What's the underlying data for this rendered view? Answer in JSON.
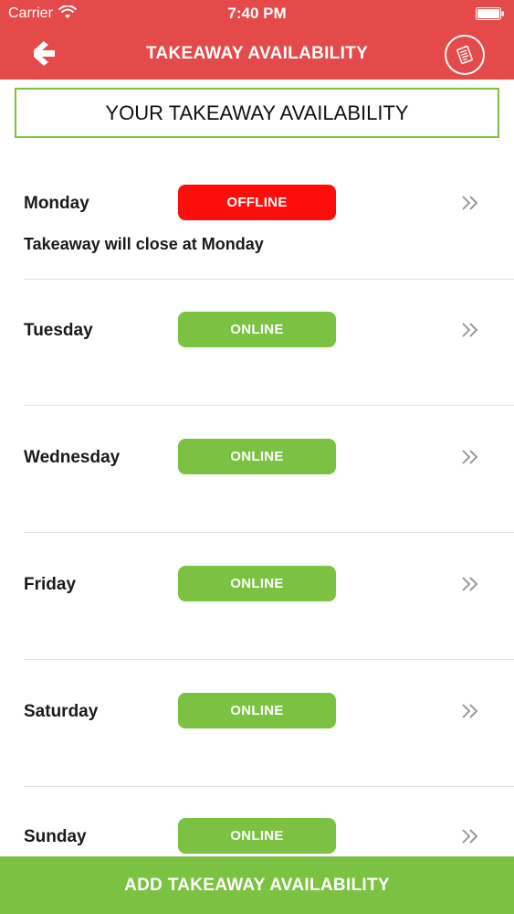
{
  "status_bar": {
    "carrier": "Carrier",
    "time": "7:40 PM"
  },
  "nav": {
    "title": "TAKEAWAY AVAILABILITY",
    "back_icon": "arrow-left-icon",
    "action_icon": "receipt-icon"
  },
  "header": {
    "title": "YOUR TAKEAWAY AVAILABILITY"
  },
  "days": [
    {
      "day": "Monday",
      "status": "OFFLINE",
      "note": "Takeaway will close at Monday"
    },
    {
      "day": "Tuesday",
      "status": "ONLINE",
      "note": ""
    },
    {
      "day": "Wednesday",
      "status": "ONLINE",
      "note": ""
    },
    {
      "day": "Friday",
      "status": "ONLINE",
      "note": ""
    },
    {
      "day": "Saturday",
      "status": "ONLINE",
      "note": ""
    },
    {
      "day": "Sunday",
      "status": "ONLINE",
      "note": ""
    }
  ],
  "footer": {
    "add_label": "ADD TAKEAWAY AVAILABILITY"
  },
  "colors": {
    "brand_red": "#e34a49",
    "online_green": "#7cc242",
    "offline_red": "#ff0d0d"
  }
}
